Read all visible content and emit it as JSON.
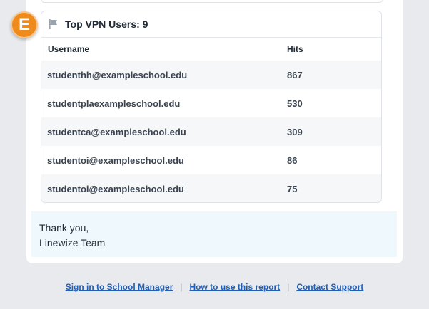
{
  "badge": {
    "letter": "E",
    "color": "#ef8a1c"
  },
  "panel": {
    "title": "Top VPN Users: 9",
    "icon": "flag-icon",
    "columns": {
      "username": "Username",
      "hits": "Hits"
    },
    "rows": [
      {
        "username": "studenthh@exampleschool.edu",
        "hits": "867"
      },
      {
        "username": "studentplaexampleschool.edu",
        "hits": "530"
      },
      {
        "username": "studentca@exampleschool.edu",
        "hits": "309"
      },
      {
        "username": "studentoi@exampleschool.edu",
        "hits": "86"
      },
      {
        "username": "studentoi@exampleschool.edu",
        "hits": "75"
      }
    ]
  },
  "thanks": {
    "line1": "Thank you,",
    "line2": "Linewize Team"
  },
  "footer": {
    "links": [
      "Sign in to School Manager",
      "How to use this report",
      "Contact Support"
    ],
    "separator": "|",
    "link_color": "#1f5fb8"
  }
}
